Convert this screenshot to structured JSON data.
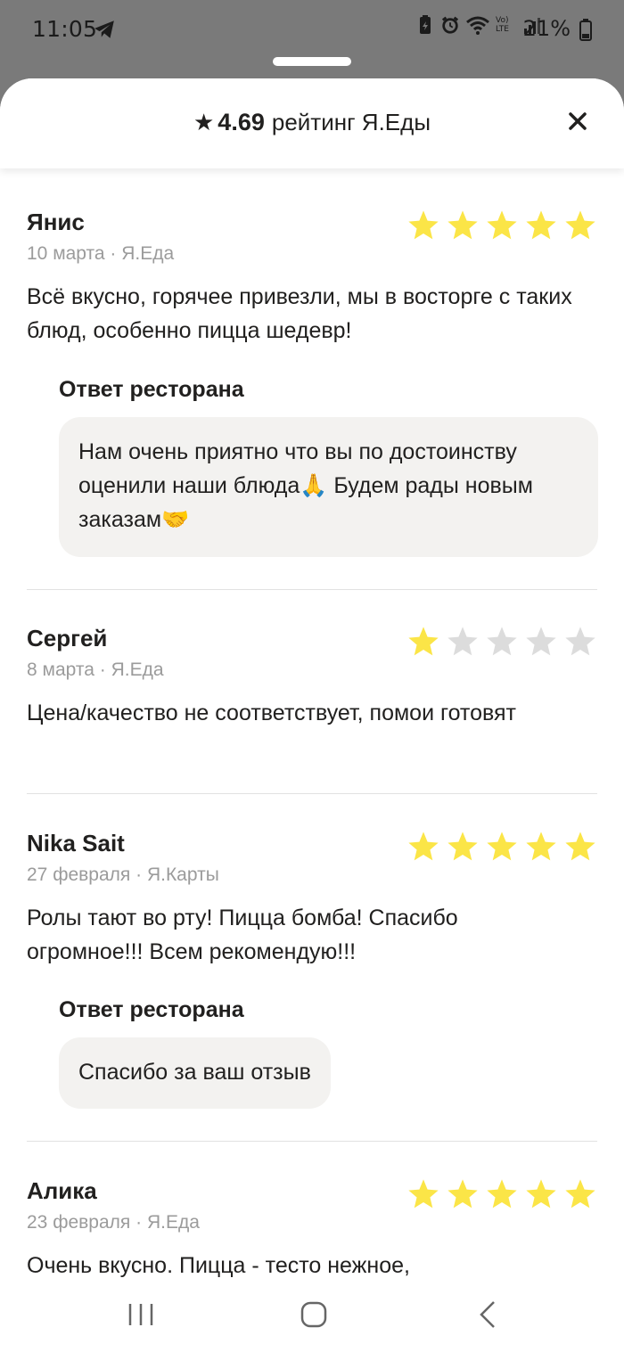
{
  "status_bar": {
    "time": "11:05",
    "battery": "21%",
    "network": "Vo) LTE"
  },
  "header": {
    "star": "★",
    "rating": "4.69",
    "label": "рейтинг Я.Еды"
  },
  "icons": {
    "close": "close-icon",
    "star": "star-icon",
    "telegram": "telegram-icon"
  },
  "colors": {
    "star_active": "#fbe547",
    "star_inactive": "#dcdcdc",
    "reply_bg": "#f3f2f0"
  },
  "reviews": [
    {
      "name": "Янис",
      "rating": 5,
      "meta": "10 марта · Я.Еда",
      "text": "Всё вкусно, горячее привезли, мы в восторге с таких блюд, особенно пицца шедевр!",
      "reply_title": "Ответ ресторана",
      "reply_text": "Нам очень приятно что вы по достоинству оценили наши блюда🙏 Будем рады новым заказам🤝"
    },
    {
      "name": "Сергей",
      "rating": 1,
      "meta": "8 марта · Я.Еда",
      "text": "Цена/качество не соответствует, помои готовят"
    },
    {
      "name": "Nika Sait",
      "rating": 5,
      "meta": "27 февраля · Я.Карты",
      "text": "Ролы тают во рту! Пицца бомба! Спасибо огромное!!! Всем рекомендую!!!",
      "reply_title": "Ответ ресторана",
      "reply_text": "Спасибо за ваш отзыв"
    },
    {
      "name": "Алика",
      "rating": 5,
      "meta": "23 февраля · Я.Еда",
      "text": "Очень вкусно. Пицца - тесто нежное,"
    }
  ]
}
